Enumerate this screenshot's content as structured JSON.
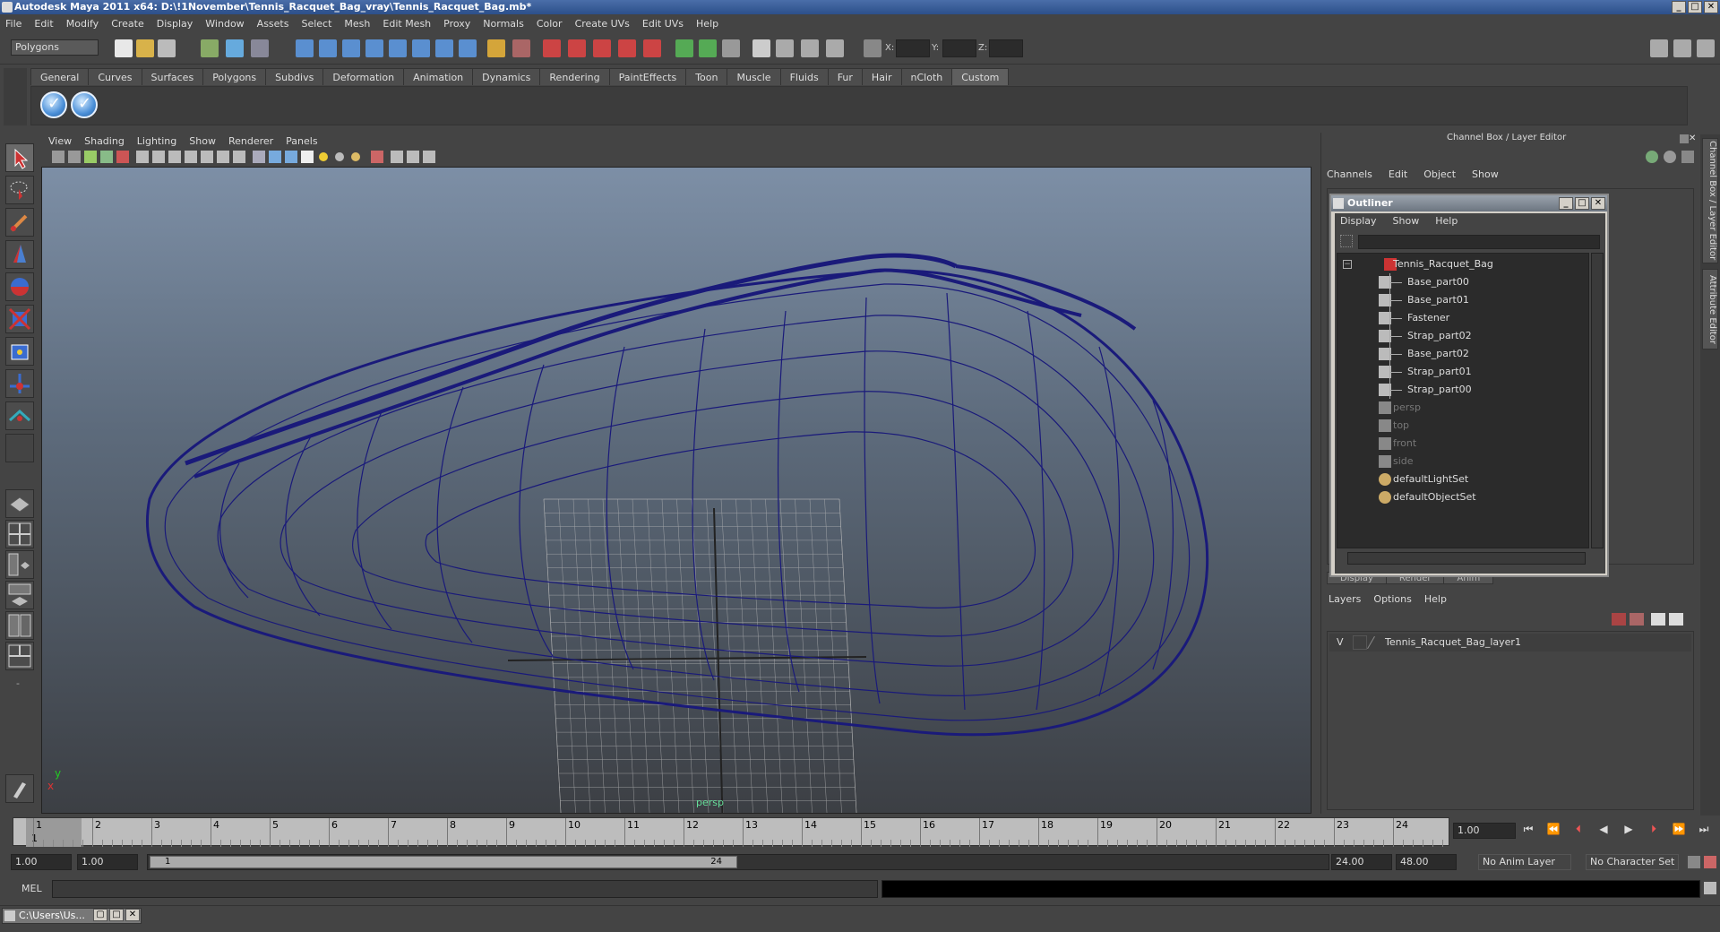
{
  "window": {
    "title": "Autodesk Maya 2011 x64: D:\\!1November\\Tennis_Racquet_Bag_vray\\Tennis_Racquet_Bag.mb*"
  },
  "menubar": [
    "File",
    "Edit",
    "Modify",
    "Create",
    "Display",
    "Window",
    "Assets",
    "Select",
    "Mesh",
    "Edit Mesh",
    "Proxy",
    "Normals",
    "Color",
    "Create UVs",
    "Edit UVs",
    "Help"
  ],
  "statusline": {
    "mode": "Polygons",
    "x_label": "X:",
    "y_label": "Y:",
    "z_label": "Z:"
  },
  "shelf": {
    "tabs": [
      "General",
      "Curves",
      "Surfaces",
      "Polygons",
      "Subdivs",
      "Deformation",
      "Animation",
      "Dynamics",
      "Rendering",
      "PaintEffects",
      "Toon",
      "Muscle",
      "Fluids",
      "Fur",
      "Hair",
      "nCloth",
      "Custom"
    ],
    "active_tab": "Custom"
  },
  "viewport": {
    "menu": [
      "View",
      "Shading",
      "Lighting",
      "Show",
      "Renderer",
      "Panels"
    ],
    "camera_label": "persp",
    "axis_y": "y",
    "axis_x": "x",
    "wire_color": "#1a1a7a"
  },
  "channelbox": {
    "title": "Channel Box / Layer Editor",
    "menu": [
      "Channels",
      "Edit",
      "Object",
      "Show"
    ]
  },
  "sidetabs": [
    "Channel Box / Layer Editor",
    "Attribute Editor"
  ],
  "outliner": {
    "title": "Outliner",
    "menu": [
      "Display",
      "Show",
      "Help"
    ],
    "items": [
      {
        "label": "Tennis_Racquet_Bag",
        "indent": 0,
        "dim": false,
        "kind": "group"
      },
      {
        "label": "Base_part00",
        "indent": 1,
        "dim": false,
        "kind": "mesh"
      },
      {
        "label": "Base_part01",
        "indent": 1,
        "dim": false,
        "kind": "mesh"
      },
      {
        "label": "Fastener",
        "indent": 1,
        "dim": false,
        "kind": "mesh"
      },
      {
        "label": "Strap_part02",
        "indent": 1,
        "dim": false,
        "kind": "mesh"
      },
      {
        "label": "Base_part02",
        "indent": 1,
        "dim": false,
        "kind": "mesh"
      },
      {
        "label": "Strap_part01",
        "indent": 1,
        "dim": false,
        "kind": "mesh"
      },
      {
        "label": "Strap_part00",
        "indent": 1,
        "dim": false,
        "kind": "mesh"
      },
      {
        "label": "persp",
        "indent": 0,
        "dim": true,
        "kind": "camera"
      },
      {
        "label": "top",
        "indent": 0,
        "dim": true,
        "kind": "camera"
      },
      {
        "label": "front",
        "indent": 0,
        "dim": true,
        "kind": "camera"
      },
      {
        "label": "side",
        "indent": 0,
        "dim": true,
        "kind": "camera"
      },
      {
        "label": "defaultLightSet",
        "indent": 0,
        "dim": false,
        "kind": "set"
      },
      {
        "label": "defaultObjectSet",
        "indent": 0,
        "dim": false,
        "kind": "set"
      }
    ]
  },
  "layers": {
    "tabs": [
      "Display",
      "Render",
      "Anim"
    ],
    "menu": [
      "Layers",
      "Options",
      "Help"
    ],
    "rows": [
      {
        "visible": "V",
        "name": "Tennis_Racquet_Bag_layer1"
      }
    ]
  },
  "timeslider": {
    "frames": [
      "1",
      "2",
      "3",
      "4",
      "5",
      "6",
      "7",
      "8",
      "9",
      "10",
      "11",
      "12",
      "13",
      "14",
      "15",
      "16",
      "17",
      "18",
      "19",
      "20",
      "21",
      "22",
      "23",
      "24"
    ],
    "current_frame": "1.00",
    "current_marker": "1"
  },
  "range": {
    "start": "1.00",
    "start2": "1.00",
    "inner_start": "1",
    "inner_end": "24",
    "end": "24.00",
    "end2": "48.00",
    "anim_layer": "No Anim Layer",
    "char_set": "No Character Set"
  },
  "cmdline": {
    "label": "MEL"
  },
  "taskbar": {
    "item": "C:\\Users\\Us..."
  }
}
